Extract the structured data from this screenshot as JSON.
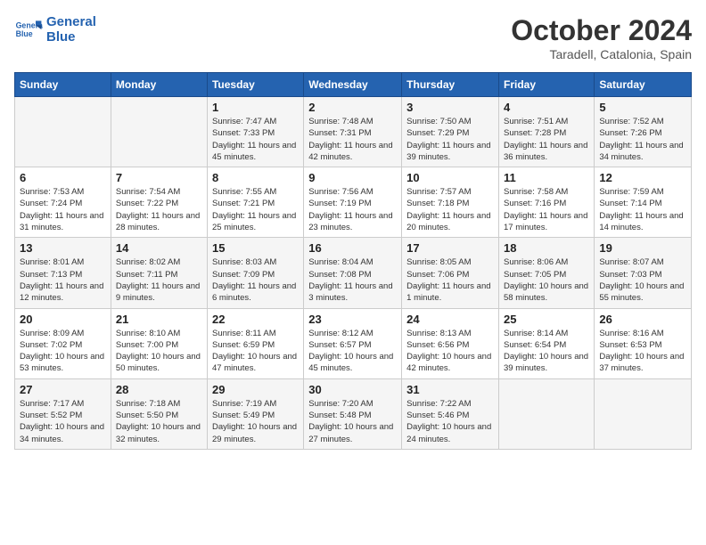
{
  "header": {
    "logo_line1": "General",
    "logo_line2": "Blue",
    "month_title": "October 2024",
    "location": "Taradell, Catalonia, Spain"
  },
  "days_of_week": [
    "Sunday",
    "Monday",
    "Tuesday",
    "Wednesday",
    "Thursday",
    "Friday",
    "Saturday"
  ],
  "weeks": [
    [
      {
        "day": "",
        "detail": ""
      },
      {
        "day": "",
        "detail": ""
      },
      {
        "day": "1",
        "detail": "Sunrise: 7:47 AM\nSunset: 7:33 PM\nDaylight: 11 hours and 45 minutes."
      },
      {
        "day": "2",
        "detail": "Sunrise: 7:48 AM\nSunset: 7:31 PM\nDaylight: 11 hours and 42 minutes."
      },
      {
        "day": "3",
        "detail": "Sunrise: 7:50 AM\nSunset: 7:29 PM\nDaylight: 11 hours and 39 minutes."
      },
      {
        "day": "4",
        "detail": "Sunrise: 7:51 AM\nSunset: 7:28 PM\nDaylight: 11 hours and 36 minutes."
      },
      {
        "day": "5",
        "detail": "Sunrise: 7:52 AM\nSunset: 7:26 PM\nDaylight: 11 hours and 34 minutes."
      }
    ],
    [
      {
        "day": "6",
        "detail": "Sunrise: 7:53 AM\nSunset: 7:24 PM\nDaylight: 11 hours and 31 minutes."
      },
      {
        "day": "7",
        "detail": "Sunrise: 7:54 AM\nSunset: 7:22 PM\nDaylight: 11 hours and 28 minutes."
      },
      {
        "day": "8",
        "detail": "Sunrise: 7:55 AM\nSunset: 7:21 PM\nDaylight: 11 hours and 25 minutes."
      },
      {
        "day": "9",
        "detail": "Sunrise: 7:56 AM\nSunset: 7:19 PM\nDaylight: 11 hours and 23 minutes."
      },
      {
        "day": "10",
        "detail": "Sunrise: 7:57 AM\nSunset: 7:18 PM\nDaylight: 11 hours and 20 minutes."
      },
      {
        "day": "11",
        "detail": "Sunrise: 7:58 AM\nSunset: 7:16 PM\nDaylight: 11 hours and 17 minutes."
      },
      {
        "day": "12",
        "detail": "Sunrise: 7:59 AM\nSunset: 7:14 PM\nDaylight: 11 hours and 14 minutes."
      }
    ],
    [
      {
        "day": "13",
        "detail": "Sunrise: 8:01 AM\nSunset: 7:13 PM\nDaylight: 11 hours and 12 minutes."
      },
      {
        "day": "14",
        "detail": "Sunrise: 8:02 AM\nSunset: 7:11 PM\nDaylight: 11 hours and 9 minutes."
      },
      {
        "day": "15",
        "detail": "Sunrise: 8:03 AM\nSunset: 7:09 PM\nDaylight: 11 hours and 6 minutes."
      },
      {
        "day": "16",
        "detail": "Sunrise: 8:04 AM\nSunset: 7:08 PM\nDaylight: 11 hours and 3 minutes."
      },
      {
        "day": "17",
        "detail": "Sunrise: 8:05 AM\nSunset: 7:06 PM\nDaylight: 11 hours and 1 minute."
      },
      {
        "day": "18",
        "detail": "Sunrise: 8:06 AM\nSunset: 7:05 PM\nDaylight: 10 hours and 58 minutes."
      },
      {
        "day": "19",
        "detail": "Sunrise: 8:07 AM\nSunset: 7:03 PM\nDaylight: 10 hours and 55 minutes."
      }
    ],
    [
      {
        "day": "20",
        "detail": "Sunrise: 8:09 AM\nSunset: 7:02 PM\nDaylight: 10 hours and 53 minutes."
      },
      {
        "day": "21",
        "detail": "Sunrise: 8:10 AM\nSunset: 7:00 PM\nDaylight: 10 hours and 50 minutes."
      },
      {
        "day": "22",
        "detail": "Sunrise: 8:11 AM\nSunset: 6:59 PM\nDaylight: 10 hours and 47 minutes."
      },
      {
        "day": "23",
        "detail": "Sunrise: 8:12 AM\nSunset: 6:57 PM\nDaylight: 10 hours and 45 minutes."
      },
      {
        "day": "24",
        "detail": "Sunrise: 8:13 AM\nSunset: 6:56 PM\nDaylight: 10 hours and 42 minutes."
      },
      {
        "day": "25",
        "detail": "Sunrise: 8:14 AM\nSunset: 6:54 PM\nDaylight: 10 hours and 39 minutes."
      },
      {
        "day": "26",
        "detail": "Sunrise: 8:16 AM\nSunset: 6:53 PM\nDaylight: 10 hours and 37 minutes."
      }
    ],
    [
      {
        "day": "27",
        "detail": "Sunrise: 7:17 AM\nSunset: 5:52 PM\nDaylight: 10 hours and 34 minutes."
      },
      {
        "day": "28",
        "detail": "Sunrise: 7:18 AM\nSunset: 5:50 PM\nDaylight: 10 hours and 32 minutes."
      },
      {
        "day": "29",
        "detail": "Sunrise: 7:19 AM\nSunset: 5:49 PM\nDaylight: 10 hours and 29 minutes."
      },
      {
        "day": "30",
        "detail": "Sunrise: 7:20 AM\nSunset: 5:48 PM\nDaylight: 10 hours and 27 minutes."
      },
      {
        "day": "31",
        "detail": "Sunrise: 7:22 AM\nSunset: 5:46 PM\nDaylight: 10 hours and 24 minutes."
      },
      {
        "day": "",
        "detail": ""
      },
      {
        "day": "",
        "detail": ""
      }
    ]
  ]
}
